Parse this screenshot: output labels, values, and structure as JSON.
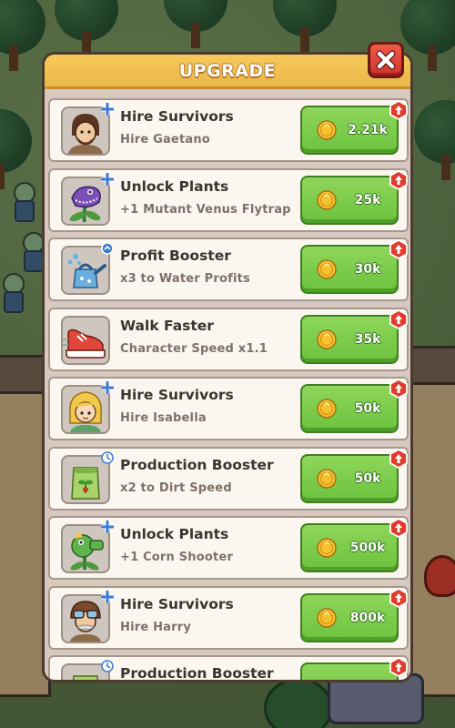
{
  "screen": {
    "title": "UPGRADE"
  },
  "colors": {
    "header": "#eab74a",
    "buy_button": "#6cc23e",
    "close_button": "#d2322b",
    "card": "#fbf7f0"
  },
  "upgrades": [
    {
      "title": "Hire Survivors",
      "subtitle": "Hire Gaetano",
      "price": "2.21k",
      "icon": "survivor-gaetano-icon",
      "badge": "plus"
    },
    {
      "title": "Unlock Plants",
      "subtitle": "+1 Mutant Venus Flytrap",
      "price": "25k",
      "icon": "venus-flytrap-icon",
      "badge": "plus"
    },
    {
      "title": "Profit Booster",
      "subtitle": "x3 to Water Profits",
      "price": "30k",
      "icon": "watering-can-icon",
      "badge": "profit"
    },
    {
      "title": "Walk Faster",
      "subtitle": "Character Speed x1.1",
      "price": "35k",
      "icon": "sneaker-icon",
      "badge": "none"
    },
    {
      "title": "Hire Survivors",
      "subtitle": "Hire Isabella",
      "price": "50k",
      "icon": "survivor-isabella-icon",
      "badge": "plus"
    },
    {
      "title": "Production Booster",
      "subtitle": "x2 to Dirt Speed",
      "price": "50k",
      "icon": "seed-bag-icon",
      "badge": "speed"
    },
    {
      "title": "Unlock Plants",
      "subtitle": "+1 Corn Shooter",
      "price": "500k",
      "icon": "corn-shooter-icon",
      "badge": "plus"
    },
    {
      "title": "Hire Survivors",
      "subtitle": "Hire Harry",
      "price": "800k",
      "icon": "survivor-harry-icon",
      "badge": "plus"
    },
    {
      "title": "Production Booster",
      "subtitle": "",
      "price": "",
      "icon": "production-booster-icon",
      "badge": "speed"
    }
  ]
}
